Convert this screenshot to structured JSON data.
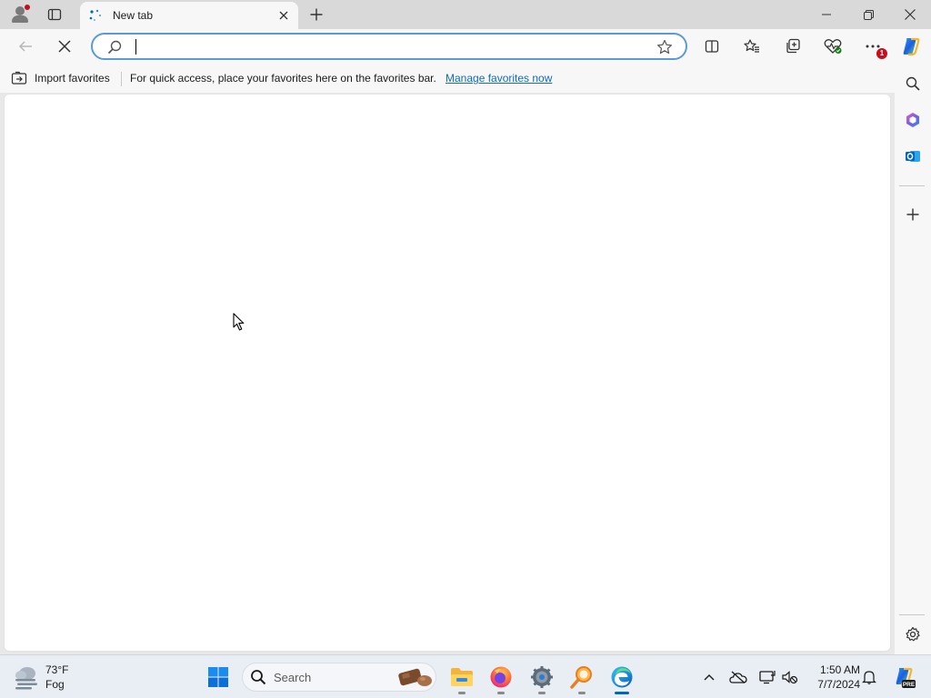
{
  "tab": {
    "title": "New tab"
  },
  "address_bar": {
    "value": "",
    "placeholder": ""
  },
  "favorites_bar": {
    "import_label": "Import favorites",
    "message": "For quick access, place your favorites here on the favorites bar.",
    "link": "Manage favorites now"
  },
  "notifications_badge": "1",
  "taskbar": {
    "weather": {
      "temp": "73°F",
      "condition": "Fog"
    },
    "search_label": "Search",
    "clock": {
      "time": "1:50 AM",
      "date": "7/7/2024"
    },
    "copilot_badge": "PRE"
  },
  "colors": {
    "accent": "#0067c0",
    "link": "#0f6cbd",
    "badge": "#c50f1f",
    "address_focus": "#5b9bd5"
  },
  "icons": [
    "profile-icon",
    "tab-actions-icon",
    "loading-spinner-icon",
    "close-icon",
    "plus-icon",
    "minimize-icon",
    "restore-icon",
    "back-icon",
    "stop-icon",
    "search-icon",
    "star-icon",
    "split-screen-icon",
    "favorites-icon",
    "collections-icon",
    "browser-essentials-icon",
    "more-icon",
    "copilot-icon",
    "office-icon",
    "outlook-icon",
    "settings-icon",
    "windows-start-icon",
    "file-explorer-icon",
    "firefox-icon",
    "edge-icon",
    "chevron-up-icon",
    "onedrive-icon",
    "bell-icon"
  ]
}
